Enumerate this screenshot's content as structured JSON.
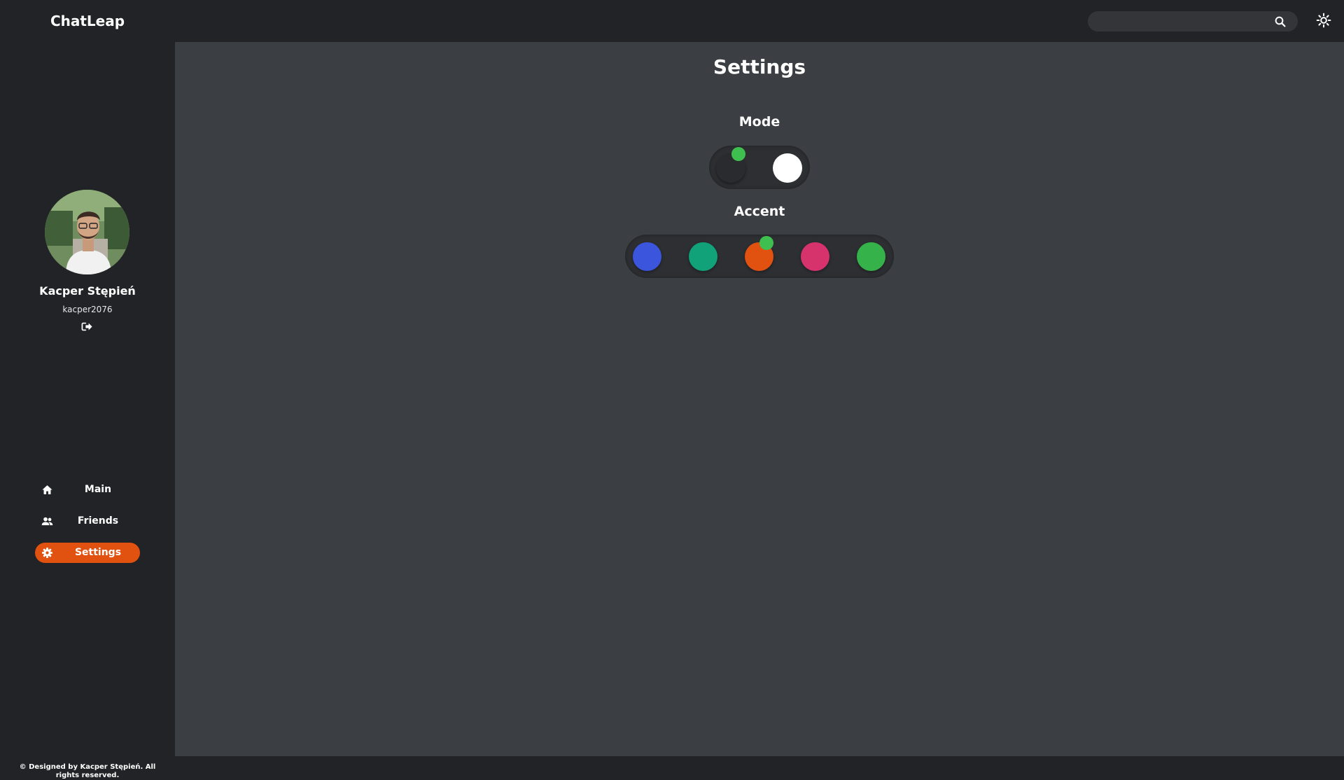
{
  "app": {
    "brand": "ChatLeap"
  },
  "search": {
    "placeholder": "",
    "value": ""
  },
  "user": {
    "name": "Kacper Stępień",
    "handle": "kacper2076"
  },
  "nav": {
    "items": [
      {
        "label": "Main",
        "icon": "home-icon",
        "active": false
      },
      {
        "label": "Friends",
        "icon": "friends-icon",
        "active": false
      },
      {
        "label": "Settings",
        "icon": "gear-icon",
        "active": true
      }
    ]
  },
  "footer": {
    "text": "© Designed by Kacper Stępień. All rights reserved."
  },
  "settings": {
    "title": "Settings",
    "mode": {
      "title": "Mode",
      "options": [
        {
          "name": "dark",
          "color": "#2a2b2e",
          "selected": true
        },
        {
          "name": "light",
          "color": "#ffffff",
          "selected": false
        }
      ]
    },
    "accent": {
      "title": "Accent",
      "options": [
        {
          "name": "blue",
          "color": "#3b55dc",
          "selected": false
        },
        {
          "name": "teal",
          "color": "#12a27a",
          "selected": false
        },
        {
          "name": "orange",
          "color": "#e1510f",
          "selected": true
        },
        {
          "name": "pink",
          "color": "#d6336c",
          "selected": false
        },
        {
          "name": "green",
          "color": "#35b34a",
          "selected": false
        }
      ]
    },
    "selection_indicator_color": "#3fbf4f"
  }
}
